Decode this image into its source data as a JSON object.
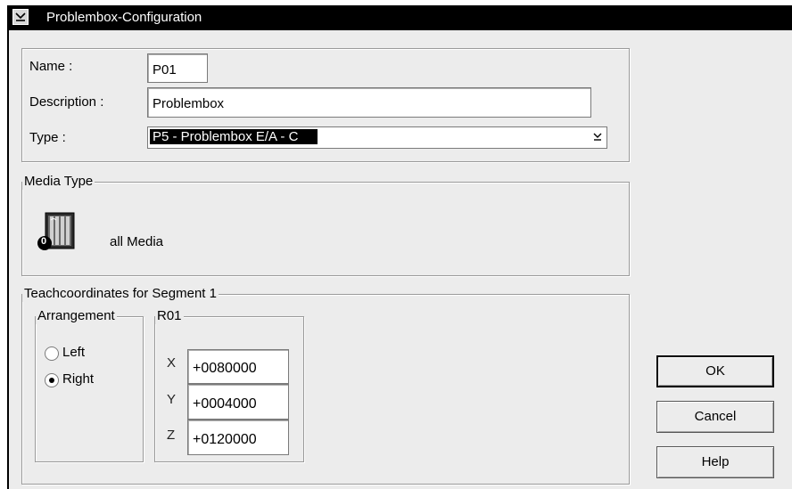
{
  "window": {
    "title": "Problembox-Configuration"
  },
  "form": {
    "name_label": "Name :",
    "name_value": "P01",
    "description_label": "Description :",
    "description_value": "Problembox",
    "type_label": "Type :",
    "type_value": "P5  -  Problembox E/A - C"
  },
  "media": {
    "legend": "Media Type",
    "icon": "media-cabinet-icon",
    "icon_badge": "0",
    "label": "all Media"
  },
  "teach": {
    "legend": "Teachcoordinates for Segment 1",
    "arrangement": {
      "legend": "Arrangement",
      "options": [
        {
          "label": "Left",
          "selected": false
        },
        {
          "label": "Right",
          "selected": true
        }
      ]
    },
    "robot": {
      "legend": "R01",
      "x_label": "X",
      "x_value": "+0080000",
      "y_label": "Y",
      "y_value": "+0004000",
      "z_label": "Z",
      "z_value": "+0120000"
    }
  },
  "buttons": {
    "ok": "OK",
    "cancel": "Cancel",
    "help": "Help"
  }
}
